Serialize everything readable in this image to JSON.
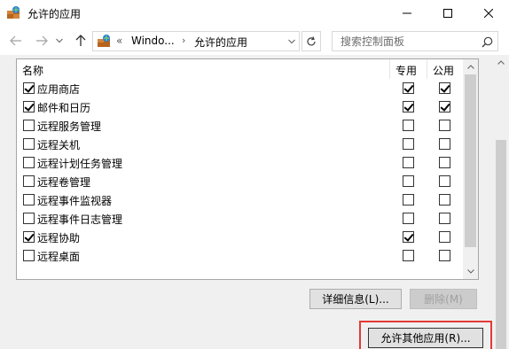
{
  "window": {
    "title": "允许的应用",
    "icon": "firewall-app-icon"
  },
  "nav": {
    "address_prefix": "«",
    "address_segment1": "Windo...",
    "address_separator": "›",
    "address_segment2": "允许的应用",
    "search_placeholder": "搜索控制面板"
  },
  "list": {
    "header_name": "名称",
    "header_private": "专用",
    "header_public": "公用",
    "rows": [
      {
        "name": "应用商店",
        "enabled": true,
        "private": true,
        "public": true
      },
      {
        "name": "邮件和日历",
        "enabled": true,
        "private": true,
        "public": true
      },
      {
        "name": "远程服务管理",
        "enabled": false,
        "private": false,
        "public": false
      },
      {
        "name": "远程关机",
        "enabled": false,
        "private": false,
        "public": false
      },
      {
        "name": "远程计划任务管理",
        "enabled": false,
        "private": false,
        "public": false
      },
      {
        "name": "远程卷管理",
        "enabled": false,
        "private": false,
        "public": false
      },
      {
        "name": "远程事件监视器",
        "enabled": false,
        "private": false,
        "public": false
      },
      {
        "name": "远程事件日志管理",
        "enabled": false,
        "private": false,
        "public": false
      },
      {
        "name": "远程协助",
        "enabled": true,
        "private": true,
        "public": false
      },
      {
        "name": "远程桌面",
        "enabled": false,
        "private": false,
        "public": false
      }
    ]
  },
  "buttons": {
    "details": "详细信息(L)...",
    "remove": "删除(M)",
    "allow_other": "允许其他应用(R)..."
  },
  "colors": {
    "highlight": "#e53935",
    "panel_bg": "#f0f0f0"
  }
}
